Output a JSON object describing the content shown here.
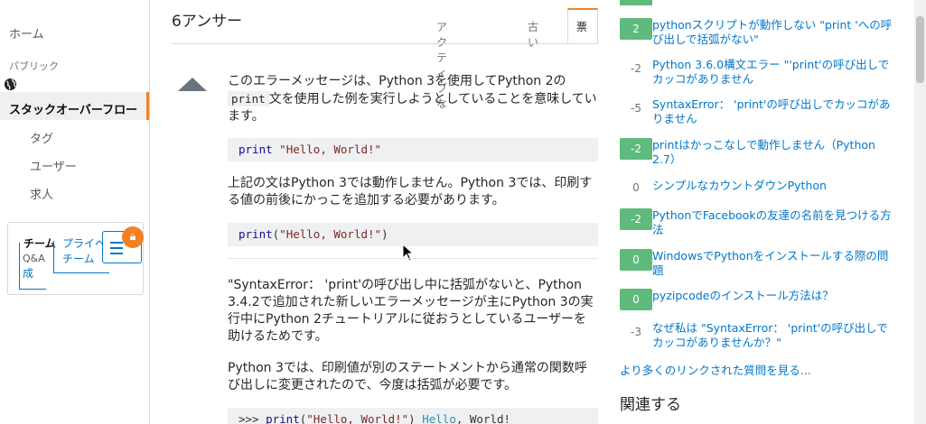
{
  "left_nav": {
    "home": "ホーム",
    "public": "パブリック",
    "stackoverflow": "スタックオーバーフロー",
    "tags": "タグ",
    "users": "ユーザー",
    "jobs": "求人",
    "teams_title": "チーム",
    "teams_qa": "Q&A",
    "teams_create": "成",
    "teams_private": "プライベ",
    "teams_team": "チーム"
  },
  "answers_header": {
    "count": "6アンサー",
    "tabs": [
      "アクティブな",
      "古い",
      "票"
    ]
  },
  "answer": {
    "para1_a": "このエラーメッセージは、Python 3を使用してPython 2の",
    "para1_code": "print",
    "para1_b": "文を使用した例を実行しようとしていることを意味しています。",
    "code1_kw": "print",
    "code1_str": "\"Hello, World!\"",
    "para2": "上記の文はPython 3では動作しません。Python 3では、印刷する値の前後にかっこを追加する必要があります。",
    "code2_kw": "print",
    "code2_open": "(",
    "code2_str": "\"Hello, World!\"",
    "code2_close": ")",
    "para3": "\"SyntaxError： 'print'の呼び出し中に括弧がないと、Python 3.4.2で追加された新しいエラーメッセージが主にPython 3の実行中にPython 2チュートリアルに従おうとしているユーザーを助けるためです。",
    "para4": "Python 3では、印刷値が別のステートメントから通常の関数呼び出しに変更されたので、今度は括弧が必要です。",
    "code3_prompt": ">>> ",
    "code3_kw": "print",
    "code3_open": "(",
    "code3_str": "\"Hello, World!\"",
    "code3_close": ")",
    "code3_out1": " Hello",
    "code3_out2": ", World!"
  },
  "linked": [
    {
      "score": "2",
      "accepted": true,
      "title": "pythonスクリプトが動作しない \"print 'への呼び出しで括弧がない\""
    },
    {
      "score": "-2",
      "accepted": false,
      "title": "Python 3.6.0構文エラー \"'print'の呼び出しでカッコがありません"
    },
    {
      "score": "-5",
      "accepted": false,
      "title": "SyntaxError： 'print'の呼び出しでカッコがありません"
    },
    {
      "score": "-2",
      "accepted": true,
      "title": "printはかっこなしで動作しません（Python 2.7）"
    },
    {
      "score": "0",
      "accepted": false,
      "title": "シンプルなカウントダウンPython"
    },
    {
      "score": "-2",
      "accepted": true,
      "title": "PythonでFacebookの友達の名前を見つける方法"
    },
    {
      "score": "0",
      "accepted": true,
      "title": "WindowsでPythonをインストールする際の問題"
    },
    {
      "score": "0",
      "accepted": true,
      "title": "pyzipcodeのインストール方法は？"
    },
    {
      "score": "-3",
      "accepted": false,
      "title": "なぜ私は \"SyntaxError： 'print'の呼び出しでカッコがありませんか？\""
    }
  ],
  "more_link": "より多くのリンクされた質問を見る...",
  "related_heading": "関連する",
  "colors": {
    "accent": "#f48024",
    "link": "#0077cc",
    "accepted": "#5eba7d"
  }
}
